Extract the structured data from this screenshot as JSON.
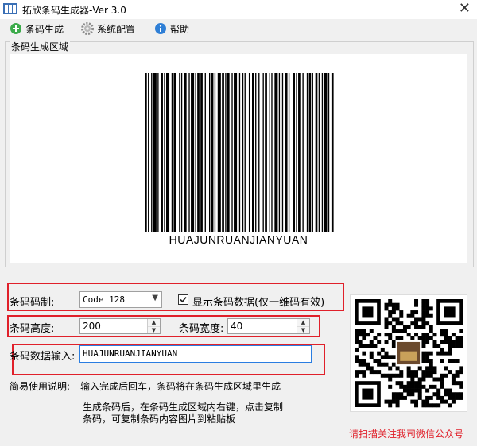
{
  "window": {
    "title": "拓欣条码生成器-Ver 3.0"
  },
  "menu": {
    "items": [
      {
        "label": "条码生成",
        "icon": "plus-icon"
      },
      {
        "label": "系统配置",
        "icon": "gear-icon"
      },
      {
        "label": "帮助",
        "icon": "info-icon"
      }
    ]
  },
  "area": {
    "title": "条码生成区域",
    "barcode_text": "HUAJUNRUANJIANYUAN"
  },
  "form": {
    "symbology_label": "条码码制:",
    "symbology_value": "Code 128",
    "show_data_label": "显示条码数据(仅一维码有效)",
    "show_data_checked": true,
    "height_label": "条码高度:",
    "height_value": "200",
    "width_label": "条码宽度:",
    "width_value": "40",
    "data_label": "条码数据输入:",
    "data_value": "HUAJUNRUANJIANYUAN"
  },
  "instructions": {
    "label": "简易使用说明:",
    "line1": "输入完成后回车，条码将在条码生成区域里生成",
    "line2": "生成条码后，在条码生成区域内右键，点击复制",
    "line3": "条码，可复制条码内容图片到粘贴板"
  },
  "qr": {
    "caption": "请扫描关注我司微信公众号"
  },
  "colors": {
    "highlight": "#e0202a",
    "focus": "#2a7de1"
  }
}
